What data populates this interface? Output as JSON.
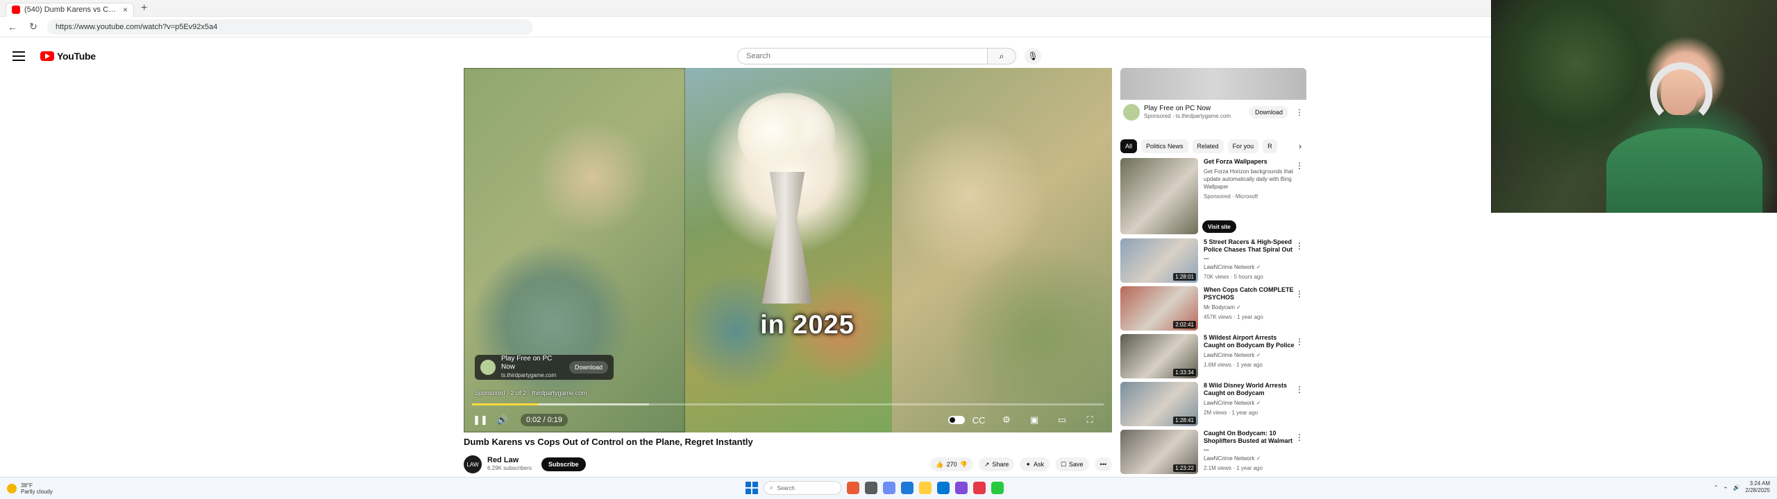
{
  "browser": {
    "tab_title": "(540) Dumb Karens vs Cops O",
    "tab_close": "×",
    "new_tab": "+",
    "address": "https://www.youtube.com/watch?v=p5Ev92x5a4"
  },
  "header": {
    "logo_text": "YouTube",
    "search_placeholder": "Search",
    "search_icon": "⌕",
    "mic_icon": "🎙"
  },
  "player": {
    "caption": "in 2025",
    "ad_title": "Play Free on PC Now",
    "ad_subtitle": "ts.thirdpartygame.com",
    "ad_download": "Download",
    "sponsored": "Sponsored · 2 of 2 · thirdpartygame.com",
    "time": "0:02 / 0:19",
    "progress_fraction": 0.105,
    "buffer_fraction": 0.28,
    "pause_icon": "❚❚",
    "volume_icon": "🔊",
    "settings_icon": "⚙",
    "captions_icon": "CC",
    "theater_icon": "▭",
    "fullscreen_icon": "⛶",
    "miniplayer_icon": "▣"
  },
  "video": {
    "title": "Dumb Karens vs Cops Out of Control on the Plane, Regret Instantly",
    "channel_name": "Red Law",
    "channel_avatar": "LAW",
    "subscribers": "6.29K subscribers",
    "subscribe": "Subscribe",
    "likes": "270",
    "share": "Share",
    "ask": "Ask",
    "save": "Save",
    "more": "•••",
    "like_icon": "👍",
    "dislike_icon": "👎",
    "share_icon": "↗",
    "ask_icon": "✦",
    "save_icon": "☐"
  },
  "sidebar": {
    "ad_title": "Play Free on PC Now",
    "ad_sub": "Sponsored · ts.thirdpartygame.com",
    "ad_download": "Download",
    "filter_chips": [
      "All",
      "Politics News",
      "Related",
      "For you",
      "R"
    ],
    "chevron": "›",
    "items": [
      {
        "title": "Get Forza Wallpapers",
        "description": "Get Forza Horizon backgrounds that update automatically daily with Bing Wallpaper",
        "meta": "Sponsored · Microsoft",
        "duration": "",
        "action": "Visit site",
        "thumb_color": "#6d6e58"
      },
      {
        "title": "5 Street Racers & High-Speed Police Chases That Spiral Out ...",
        "description": "LawNCrime Network ✓",
        "meta": "70K views · 5 hours ago",
        "duration": "1:28:01",
        "action": "",
        "thumb_color": "#8ea3b8"
      },
      {
        "title": "When Cops Catch COMPLETE PSYCHOS",
        "description": "Mr Bodycam ✓",
        "meta": "457K views · 1 year ago",
        "duration": "2:02:41",
        "action": "",
        "thumb_color": "#b76758"
      },
      {
        "title": "5 Wildest Airport Arrests Caught on Bodycam By Police",
        "description": "LawNCrime Network ✓",
        "meta": "1.6M views · 1 year ago",
        "duration": "1:33:34",
        "action": "",
        "thumb_color": "#5a5c4f"
      },
      {
        "title": "8 Wild Disney World Arrests Caught on Bodycam",
        "description": "LawNCrime Network ✓",
        "meta": "2M views · 1 year ago",
        "duration": "1:28:41",
        "action": "",
        "thumb_color": "#7b8f9e"
      },
      {
        "title": "Caught On Bodycam: 10 Shoplifters Busted at Walmart ...",
        "description": "LawNCrime Network ✓",
        "meta": "2.1M views · 1 year ago",
        "duration": "1:23:22",
        "action": "",
        "thumb_color": "#6f6964"
      }
    ]
  },
  "taskbar": {
    "weather_temp": "38°F",
    "weather_desc": "Partly cloudy",
    "search": "Search",
    "time": "3:24 AM",
    "date": "2/28/2025"
  },
  "colors": {
    "brand_red": "#ff0000",
    "progress_yellow": "#ffd93d",
    "taskbar_blue": "#0a70d0"
  }
}
